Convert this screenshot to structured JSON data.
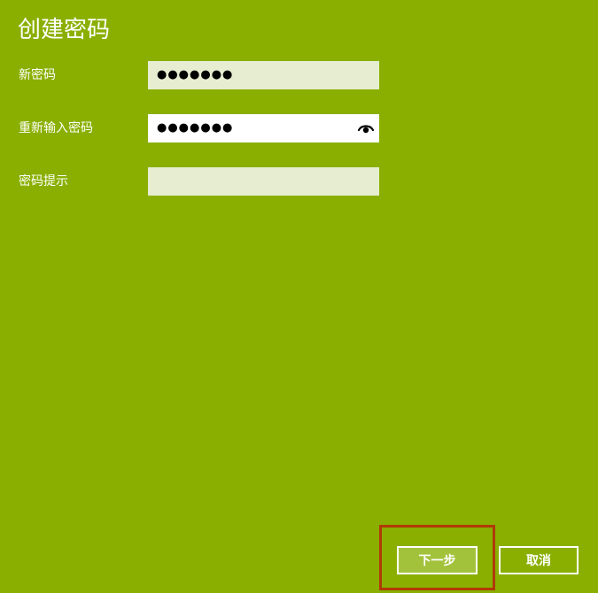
{
  "page": {
    "title": "创建密码"
  },
  "form": {
    "new_password": {
      "label": "新密码",
      "value": "●●●●●●●"
    },
    "confirm_password": {
      "label": "重新输入密码",
      "value": "●●●●●●●",
      "reveal_icon": "eye-icon"
    },
    "hint": {
      "label": "密码提示",
      "value": ""
    }
  },
  "buttons": {
    "next_label": "下一步",
    "cancel_label": "取消"
  },
  "colors": {
    "background": "#8aaf00",
    "field_background": "#e6edd1",
    "focus_frame": "#b03a06",
    "next_button": "#a3c23b"
  }
}
